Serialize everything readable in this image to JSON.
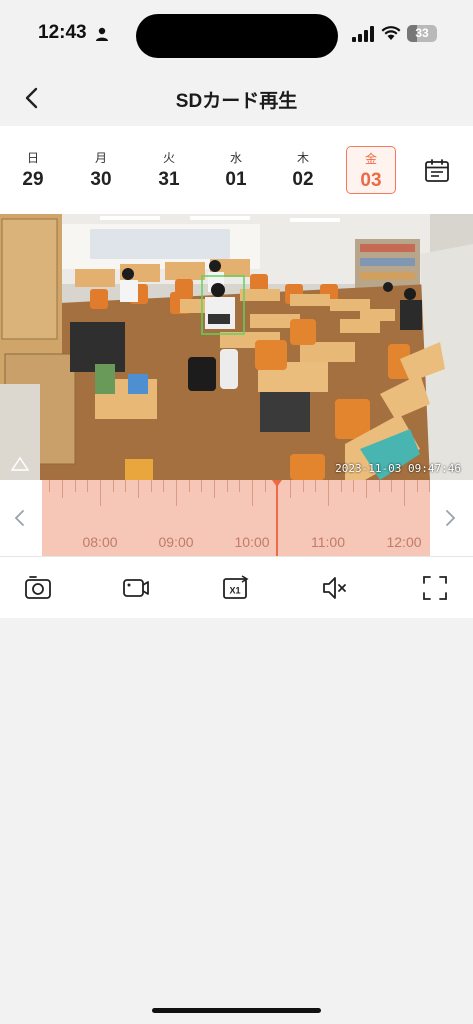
{
  "status_bar": {
    "time": "12:43",
    "battery": "33",
    "battery_level": 0.33,
    "icons": [
      "person-icon",
      "signal-icon",
      "wifi-icon",
      "battery-icon"
    ]
  },
  "header": {
    "title": "SDカード再生",
    "back_icon": "chevron-left-icon"
  },
  "date_strip": {
    "days": [
      {
        "dow": "日",
        "date": "29",
        "selected": false
      },
      {
        "dow": "月",
        "date": "30",
        "selected": false
      },
      {
        "dow": "火",
        "date": "31",
        "selected": false
      },
      {
        "dow": "水",
        "date": "01",
        "selected": false
      },
      {
        "dow": "木",
        "date": "02",
        "selected": false
      },
      {
        "dow": "金",
        "date": "03",
        "selected": true
      }
    ],
    "calendar_icon": "calendar-icon"
  },
  "video": {
    "timestamp": "2023-11-03 09:47:46"
  },
  "timeline": {
    "labels": [
      "08:00",
      "09:00",
      "10:00",
      "11:00",
      "12:00"
    ],
    "prev_icon": "chevron-left-icon",
    "next_icon": "chevron-right-icon"
  },
  "toolbar": {
    "tools": [
      {
        "name": "snapshot-button",
        "icon": "camera-icon"
      },
      {
        "name": "record-button",
        "icon": "video-camera-icon"
      },
      {
        "name": "speed-button",
        "icon": "speed-x1-icon",
        "label": "X1"
      },
      {
        "name": "mute-button",
        "icon": "speaker-muted-icon"
      },
      {
        "name": "fullscreen-button",
        "icon": "fullscreen-icon"
      }
    ]
  },
  "colors": {
    "accent": "#ec6a45",
    "timeline_fill": "#f6c7b7",
    "background": "#f2f2f2"
  }
}
